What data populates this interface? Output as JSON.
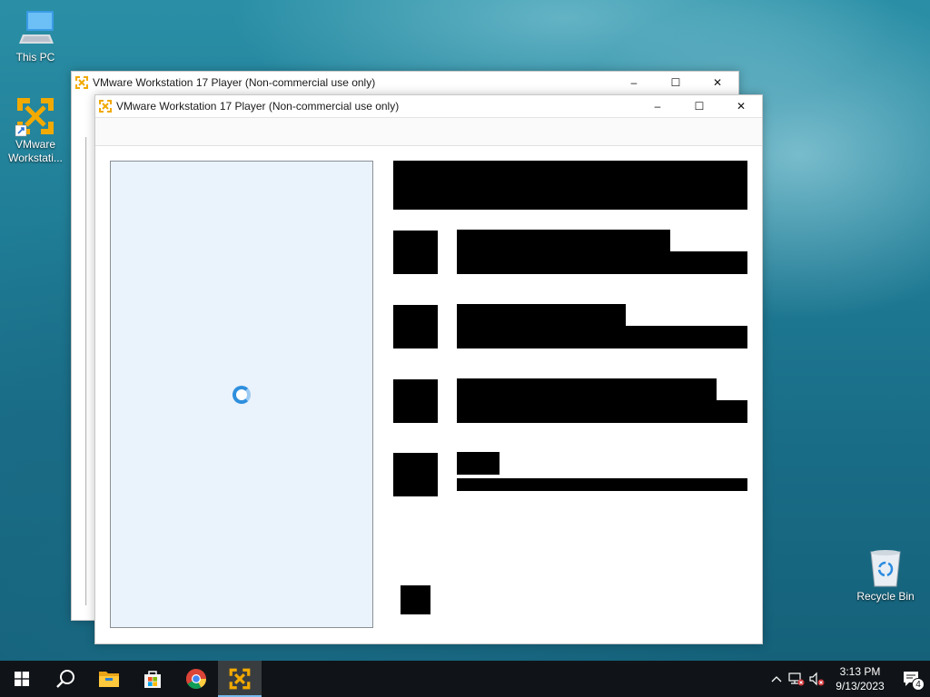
{
  "desktop": {
    "icons": [
      {
        "label": "This PC"
      },
      {
        "label": "VMware Workstati..."
      },
      {
        "label": "Recycle Bin"
      }
    ]
  },
  "windows": {
    "back": {
      "title": "VMware Workstation 17 Player (Non-commercial use only)",
      "controls": {
        "minimize": "–",
        "maximize": "☐",
        "close": "✕"
      }
    },
    "front": {
      "title": "VMware Workstation 17 Player (Non-commercial use only)",
      "controls": {
        "minimize": "–",
        "maximize": "☐",
        "close": "✕"
      }
    }
  },
  "taskbar": {
    "apps": [
      "start-icon",
      "search-icon",
      "file-explorer-icon",
      "microsoft-store-icon",
      "chrome-icon",
      "vmware-player-icon"
    ],
    "tray": {
      "time": "3:13 PM",
      "date": "9/13/2023",
      "notification_count": "4"
    }
  },
  "colors": {
    "taskbar": "#101418",
    "vmware_orange": "#f2a900",
    "preview_bg": "#eaf2fc",
    "spinner": "#2e8fdd"
  }
}
